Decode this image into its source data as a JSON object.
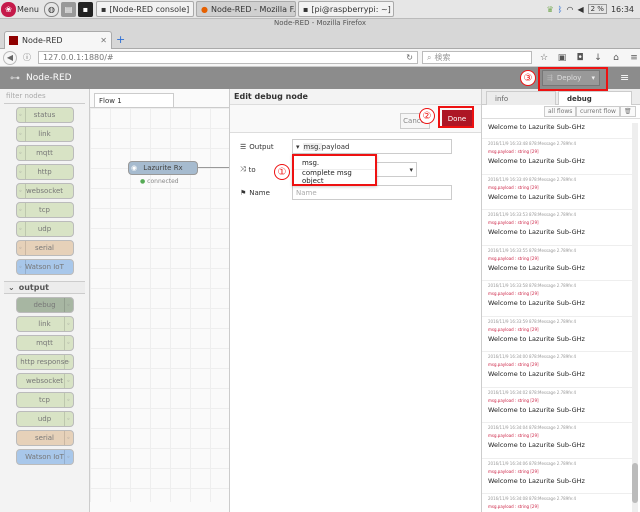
{
  "taskbar": {
    "menu_label": "Menu",
    "windows": [
      "[Node-RED console]",
      "Node-RED - Mozilla F...",
      "[pi@raspberrypi: ~]"
    ],
    "cpu": "2 %",
    "clock": "16:34"
  },
  "browser": {
    "window_title": "Node-RED - Mozilla Firefox",
    "tab_title": "Node-RED",
    "url": "127.0.0.1:1880/#",
    "search_placeholder": "検索"
  },
  "nodered": {
    "brand": "Node-RED",
    "deploy_label": "Deploy",
    "filter_placeholder": "filter nodes",
    "flow_tab": "Flow 1",
    "flow_node": "Lazurite Rx",
    "flow_status": "connected",
    "palette_top": [
      "status",
      "link",
      "mqtt",
      "http",
      "websocket",
      "tcp",
      "udp",
      "serial",
      "Watson IoT"
    ],
    "output_category": "output",
    "palette_output": [
      "debug",
      "link",
      "mqtt",
      "http response",
      "websocket",
      "tcp",
      "udp",
      "serial",
      "Watson IoT"
    ]
  },
  "editor": {
    "title": "Edit debug node",
    "cancel_label": "Cancel",
    "done_label": "Done",
    "output_label": "Output",
    "output_prefix": "msg.",
    "output_value": "payload",
    "to_label": "to",
    "name_label": "Name",
    "name_placeholder": "Name",
    "dropdown_options": [
      "msg.",
      "complete msg object"
    ]
  },
  "sidebar": {
    "tab_info": "info",
    "tab_debug": "debug",
    "all_flows": "all flows",
    "current_flow": "current flow",
    "messages": [
      {
        "meta": "",
        "topic": "",
        "payload": "Welcome to Lazurite Sub-GHz"
      },
      {
        "meta": "2016/11/9 16:33:48   878:Message 2.789fe:4",
        "topic": "msg.payload : string [29]",
        "payload": "Welcome to Lazurite Sub-GHz"
      },
      {
        "meta": "2016/11/9 16:33:49   878:Message 2.789fe:4",
        "topic": "msg.payload : string [29]",
        "payload": "Welcome to Lazurite Sub-GHz"
      },
      {
        "meta": "2016/11/9 16:33:53   878:Message 2.789fe:4",
        "topic": "msg.payload : string [29]",
        "payload": "Welcome to Lazurite Sub-GHz"
      },
      {
        "meta": "2016/11/9 16:33:55   878:Message 2.789fe:4",
        "topic": "msg.payload : string [29]",
        "payload": "Welcome to Lazurite Sub-GHz"
      },
      {
        "meta": "2016/11/9 16:33:58   878:Message 2.789fe:4",
        "topic": "msg.payload : string [29]",
        "payload": "Welcome to Lazurite Sub-GHz"
      },
      {
        "meta": "2016/11/9 16:33:59   878:Message 2.789fe:4",
        "topic": "msg.payload : string [29]",
        "payload": "Welcome to Lazurite Sub-GHz"
      },
      {
        "meta": "2016/11/9 16:34:00   878:Message 2.789fe:4",
        "topic": "msg.payload : string [29]",
        "payload": "Welcome to Lazurite Sub-GHz"
      },
      {
        "meta": "2016/11/9 16:34:02   878:Message 2.789fe:4",
        "topic": "msg.payload : string [29]",
        "payload": "Welcome to Lazurite Sub-GHz"
      },
      {
        "meta": "2016/11/9 16:34:04   878:Message 2.789fe:4",
        "topic": "msg.payload : string [29]",
        "payload": "Welcome to Lazurite Sub-GHz"
      },
      {
        "meta": "2016/11/9 16:34:06   878:Message 2.789fe:4",
        "topic": "msg.payload : string [29]",
        "payload": "Welcome to Lazurite Sub-GHz"
      },
      {
        "meta": "2016/11/9 16:34:08   878:Message 2.789fe:4",
        "topic": "msg.payload : string [29]",
        "payload": "Welcome to Lazurite Sub-GHz"
      }
    ]
  },
  "annotations": {
    "marker_1": "①",
    "marker_2": "②",
    "marker_3": "③",
    "color": "#ee1111"
  },
  "colors": {
    "header_bg": "#8c8c8c",
    "done_bg": "#ad1625",
    "flow_node": "#a6bbcf",
    "topic_text": "#cc2244"
  }
}
